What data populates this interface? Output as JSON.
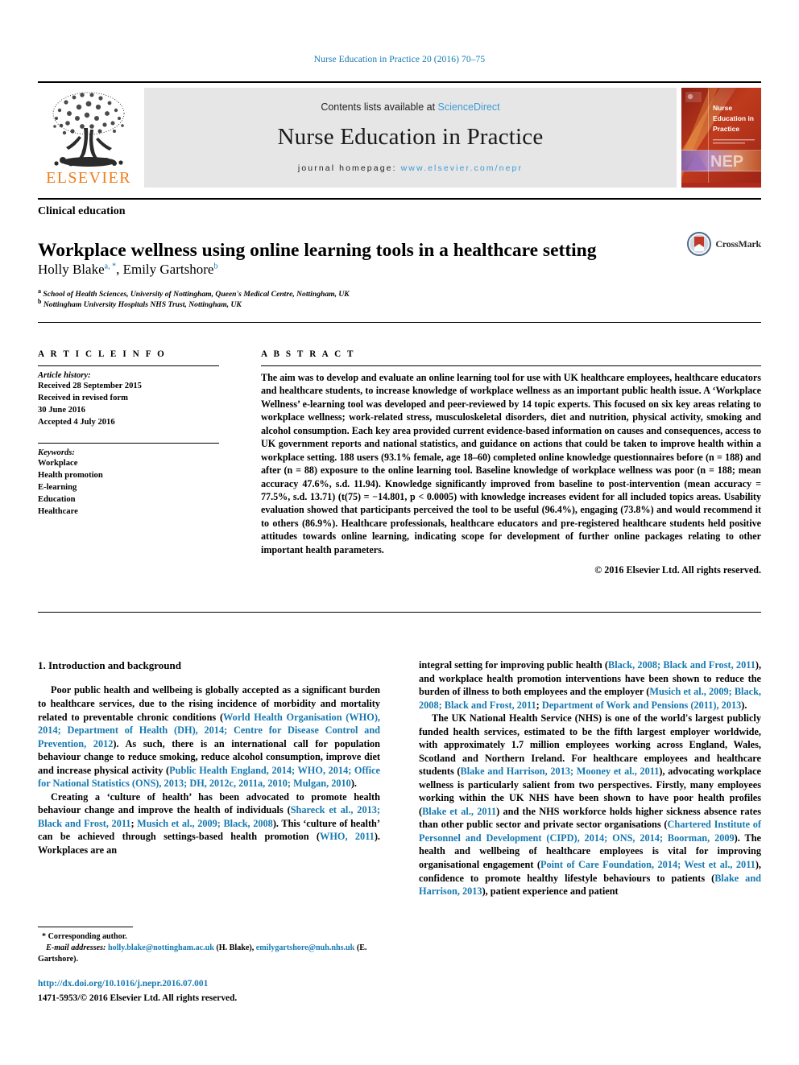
{
  "running_head": "Nurse Education in Practice 20 (2016) 70–75",
  "masthead": {
    "publisher_wordmark": "ELSEVIER",
    "contents_prefix": "Contents lists available at ",
    "contents_link": "ScienceDirect",
    "journal_name": "Nurse Education in Practice",
    "homepage_prefix": "journal homepage: ",
    "homepage_url": "www.elsevier.com/nepr",
    "cover": {
      "line1": "Nurse",
      "line2": "Education in",
      "line3": "Practice",
      "acronym": "NEP"
    }
  },
  "article": {
    "section_type": "Clinical education",
    "title": "Workplace wellness using online learning tools in a healthcare setting",
    "authors": [
      {
        "name": "Holly Blake",
        "marks": "a, *"
      },
      {
        "name": "Emily Gartshore",
        "marks": "b"
      }
    ],
    "affiliations": [
      {
        "mark": "a",
        "text": "School of Health Sciences, University of Nottingham, Queen's Medical Centre, Nottingham, UK"
      },
      {
        "mark": "b",
        "text": "Nottingham University Hospitals NHS Trust, Nottingham, UK"
      }
    ],
    "crossmark_label": "CrossMark"
  },
  "article_info": {
    "heading": "A R T I C L E   I N F O",
    "history_label": "Article history:",
    "history": [
      "Received 28 September 2015",
      "Received in revised form",
      "30 June 2016",
      "Accepted 4 July 2016"
    ],
    "keywords_label": "Keywords:",
    "keywords": [
      "Workplace",
      "Health promotion",
      "E-learning",
      "Education",
      "Healthcare"
    ]
  },
  "abstract": {
    "heading": "A B S T R A C T",
    "text": "The aim was to develop and evaluate an online learning tool for use with UK healthcare employees, healthcare educators and healthcare students, to increase knowledge of workplace wellness as an important public health issue. A ‘Workplace Wellness’ e-learning tool was developed and peer-reviewed by 14 topic experts. This focused on six key areas relating to workplace wellness; work-related stress, musculoskeletal disorders, diet and nutrition, physical activity, smoking and alcohol consumption. Each key area provided current evidence-based information on causes and consequences, access to UK government reports and national statistics, and guidance on actions that could be taken to improve health within a workplace setting. 188 users (93.1% female, age 18–60) completed online knowledge questionnaires before (n = 188) and after (n = 88) exposure to the online learning tool. Baseline knowledge of workplace wellness was poor (n = 188; mean accuracy 47.6%, s.d. 11.94). Knowledge significantly improved from baseline to post-intervention (mean accuracy = 77.5%, s.d. 13.71) (t(75) = −14.801, p < 0.0005) with knowledge increases evident for all included topics areas. Usability evaluation showed that participants perceived the tool to be useful (96.4%), engaging (73.8%) and would recommend it to others (86.9%). Healthcare professionals, healthcare educators and pre-registered healthcare students held positive attitudes towards online learning, indicating scope for development of further online packages relating to other important health parameters.",
    "copyright": "© 2016 Elsevier Ltd. All rights reserved."
  },
  "body": {
    "section_heading": "1. Introduction and background",
    "left_paragraphs": [
      "Poor public health and wellbeing is globally accepted as a significant burden to healthcare services, due to the rising incidence of morbidity and mortality related to preventable chronic conditions (World Health Organisation (WHO), 2014; Department of Health (DH), 2014; Centre for Disease Control and Prevention, 2012). As such, there is an international call for population behaviour change to reduce smoking, reduce alcohol consumption, improve diet and increase physical activity (Public Health England, 2014; WHO, 2014; Office for National Statistics (ONS), 2013; DH, 2012c, 2011a, 2010; Mulgan, 2010).",
      "Creating a ‘culture of health’ has been advocated to promote health behaviour change and improve the health of individuals (Shareck et al., 2013; Black and Frost, 2011; Musich et al., 2009; Black, 2008). This ‘culture of health’ can be achieved through settings-based health promotion (WHO, 2011). Workplaces are an"
    ],
    "right_paragraphs": [
      "integral setting for improving public health (Black, 2008; Black and Frost, 2011), and workplace health promotion interventions have been shown to reduce the burden of illness to both employees and the employer (Musich et al., 2009; Black, 2008; Black and Frost, 2011; Department of Work and Pensions (2011), 2013).",
      "The UK National Health Service (NHS) is one of the world's largest publicly funded health services, estimated to be the fifth largest employer worldwide, with approximately 1.7 million employees working across England, Wales, Scotland and Northern Ireland. For healthcare employees and healthcare students (Blake and Harrison, 2013; Mooney et al., 2011), advocating workplace wellness is particularly salient from two perspectives. Firstly, many employees working within the UK NHS have been shown to have poor health profiles (Blake et al., 2011) and the NHS workforce holds higher sickness absence rates than other public sector and private sector organisations (Chartered Institute of Personnel and Development (CIPD), 2014; ONS, 2014; Boorman, 2009). The health and wellbeing of healthcare employees is vital for improving organisational engagement (Point of Care Foundation, 2014; West et al., 2011), confidence to promote healthy lifestyle behaviours to patients (Blake and Harrison, 2013), patient experience and patient"
    ]
  },
  "footnotes": {
    "corresponding": "* Corresponding author.",
    "email_label": "E-mail addresses:",
    "email_1": "holly.blake@nottingham.ac.uk",
    "email_1_who": "(H. Blake),",
    "email_2": "emilygartshore@nuh.nhs.uk",
    "email_2_who": "(E. Gartshore).",
    "doi": "http://dx.doi.org/10.1016/j.nepr.2016.07.001",
    "issn": "1471-5953/© 2016 Elsevier Ltd. All rights reserved."
  },
  "colors": {
    "link_blue": "#1679b0",
    "sciencedirect_blue": "#3f9bd4",
    "elsevier_orange": "#f07d1b",
    "band_gray": "#e6e6e6",
    "cover_red": "#b0291c"
  }
}
